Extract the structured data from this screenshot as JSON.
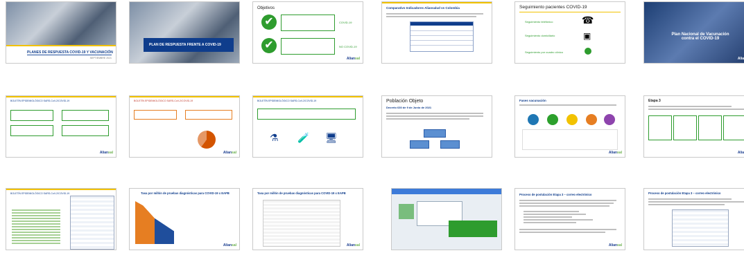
{
  "slides": [
    {
      "title": "PLANES DE RESPUESTA COVID-19 Y VACUNACIÓN",
      "subtitle": "SEPTIEMBRE 2021"
    },
    {
      "title": "PLAN DE RESPUESTA FRENTE A COVID-19"
    },
    {
      "title": "Objetivos",
      "badge1": "COVID-19",
      "badge2": "NO COVID-19"
    },
    {
      "title": "Comparativo Indicadores Aliansalud vs Colombia"
    },
    {
      "title": "Seguimiento pacientes COVID-19"
    },
    {
      "title": "Plan Nacional de Vacunación contra el COVID-19"
    },
    {
      "title": "BOLETÍN EPIDEMIOLÓGICO SARS-CoV-2/COVID-19"
    },
    {
      "title": "BOLETÍN EPIDEMIOLÓGICO SARS-CoV-2/COVID-19"
    },
    {
      "title": "BOLETÍN EPIDEMIOLÓGICO SARS-CoV-2/COVID-19"
    },
    {
      "title": "Población Objeto",
      "subtitle": "Decreto 630 de 9 de Junio de 2021"
    },
    {
      "title": "Fases vacunación"
    },
    {
      "title": "Etapa 3"
    },
    {
      "title": "BOLETÍN EPIDEMIOLÓGICO SARS-CoV-2/COVID-19"
    },
    {
      "title": "Tasa por millón de pruebas diagnósticas para COVID-19 x EAPB"
    },
    {
      "title": "Tasa por millón de pruebas diagnósticas para COVID-19 x EAPB"
    },
    {
      "title": ""
    },
    {
      "title": "Proceso de postulación Etapa 3 – correo electrónico"
    },
    {
      "title": "Proceso de postulación Etapa 3 – correo electrónico"
    }
  ],
  "brand": {
    "logo_left": "Alian",
    "logo_right": "sal"
  }
}
